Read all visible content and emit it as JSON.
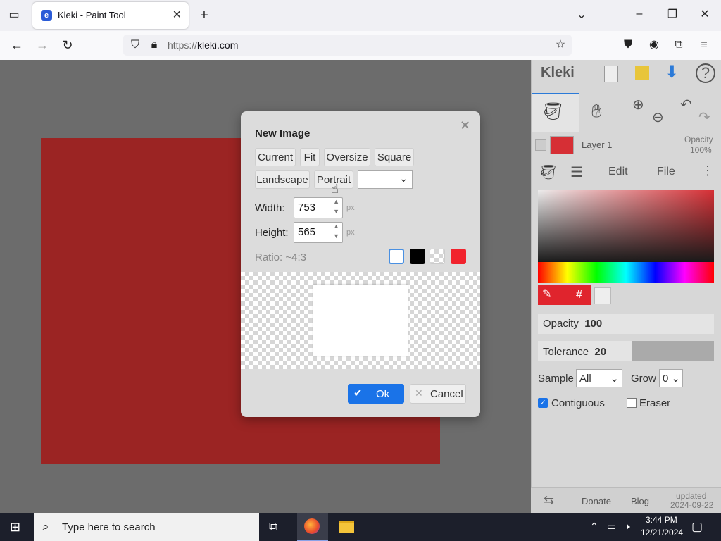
{
  "browser": {
    "tab_title": "Kleki - Paint Tool",
    "tab_favicon": "kleki-favicon-icon",
    "url_prefix": "https://",
    "url_host": "kleki.com"
  },
  "app": {
    "logo_text": "Kleki",
    "layer_name": "Layer 1",
    "opacity_label": "Opacity",
    "opacity_value": "100%",
    "tabs": {
      "edit": "Edit",
      "file": "File"
    },
    "color_hash": "#",
    "sliders": {
      "opacity_label": "Opacity",
      "opacity_value": "100",
      "tolerance_label": "Tolerance",
      "tolerance_value": "20"
    },
    "sample_label": "Sample",
    "sample_value": "All",
    "grow_label": "Grow",
    "grow_value": "0",
    "contiguous_label": "Contiguous",
    "eraser_label": "Eraser",
    "footer": {
      "donate": "Donate",
      "blog": "Blog",
      "updated_label": "updated",
      "updated_date": "2024-09-22"
    }
  },
  "dialog": {
    "title": "New Image",
    "presets_row1": [
      "Current",
      "Fit",
      "Oversize",
      "Square"
    ],
    "presets_row2": [
      "Landscape",
      "Portrait"
    ],
    "width_label": "Width:",
    "width_value": "753",
    "height_label": "Height:",
    "height_value": "565",
    "unit": "px",
    "ratio": "Ratio: ~4:3",
    "ok_label": "Ok",
    "cancel_label": "Cancel",
    "bg_colors": [
      "#ffffff",
      "#000000",
      "transparent",
      "#f1232d"
    ]
  },
  "taskbar": {
    "search_placeholder": "Type here to search",
    "time": "3:44 PM",
    "date": "12/21/2024"
  },
  "colors": {
    "canvas_red": "#9b2423",
    "layer_color": "#d62f35",
    "accent_blue": "#1a73e8"
  }
}
